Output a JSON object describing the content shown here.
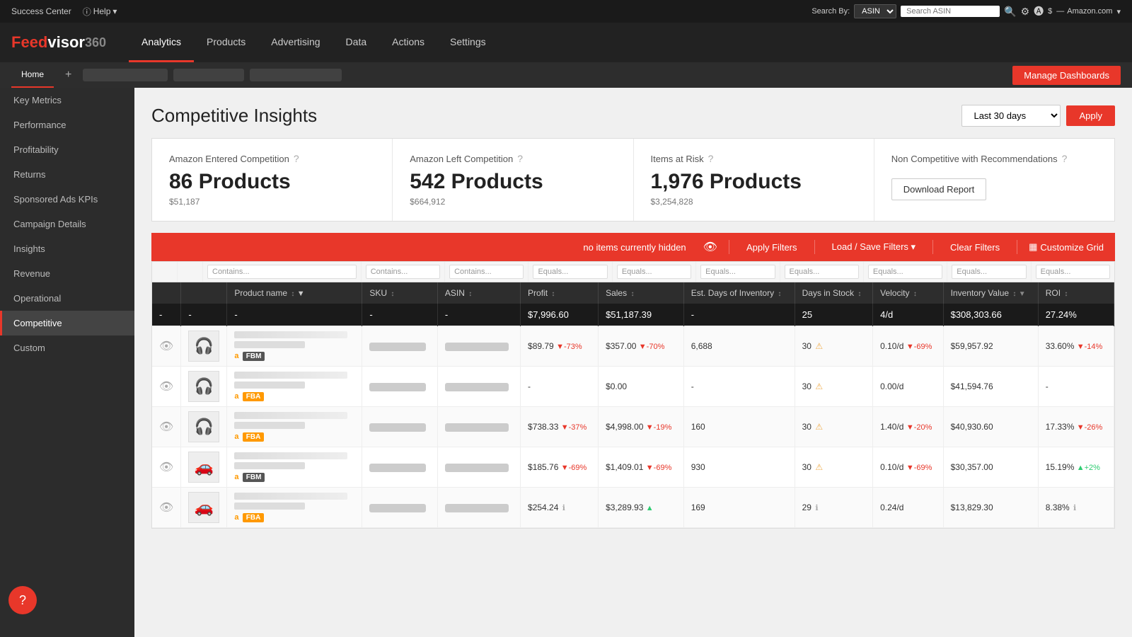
{
  "topbar": {
    "success_center": "Success Center",
    "help": "Help",
    "search_by": "Search By:",
    "search_type": "ASIN",
    "search_placeholder": "Search ASIN",
    "account_label": "Amazon.com"
  },
  "logo": {
    "feed": "Feed",
    "visor": "visor",
    "num": "360"
  },
  "nav": {
    "items": [
      {
        "label": "Analytics",
        "active": true
      },
      {
        "label": "Products",
        "active": false
      },
      {
        "label": "Advertising",
        "active": false
      },
      {
        "label": "Data",
        "active": false
      },
      {
        "label": "Actions",
        "active": false
      },
      {
        "label": "Settings",
        "active": false
      }
    ]
  },
  "tabs": {
    "home": "Home",
    "add": "+",
    "manage_dashboards": "Manage Dashboards"
  },
  "sidebar": {
    "items": [
      {
        "label": "Key Metrics",
        "active": false
      },
      {
        "label": "Performance",
        "active": false
      },
      {
        "label": "Profitability",
        "active": false
      },
      {
        "label": "Returns",
        "active": false
      },
      {
        "label": "Sponsored Ads KPIs",
        "active": false
      },
      {
        "label": "Campaign Details",
        "active": false
      },
      {
        "label": "Insights",
        "active": false
      },
      {
        "label": "Revenue",
        "active": false
      },
      {
        "label": "Operational",
        "active": false
      },
      {
        "label": "Competitive",
        "active": true
      },
      {
        "label": "Custom",
        "active": false
      }
    ]
  },
  "page": {
    "title": "Competitive Insights",
    "date_filter": "Last 30 days",
    "apply_btn": "Apply"
  },
  "cards": [
    {
      "title": "Amazon Entered Competition",
      "count": "86 Products",
      "sub": "$51,187"
    },
    {
      "title": "Amazon Left Competition",
      "count": "542 Products",
      "sub": "$664,912"
    },
    {
      "title": "Items at Risk",
      "count": "1,976 Products",
      "sub": "$3,254,828"
    },
    {
      "title": "Non Competitive with Recommendations",
      "count": "",
      "sub": "",
      "has_download": true,
      "download_label": "Download Report"
    }
  ],
  "filter_bar": {
    "hidden_text": "no items currently hidden",
    "apply_filters": "Apply Filters",
    "load_save": "Load / Save Filters",
    "clear_filters": "Clear Filters",
    "customize": "Customize Grid"
  },
  "table": {
    "col_filters": [
      "Contains...",
      "Contains...",
      "Contains...",
      "Equals...",
      "Equals...",
      "Equals...",
      "Equals...",
      "Equals...",
      "Equals...",
      "Equals..."
    ],
    "headers": [
      {
        "label": "Product name",
        "sortable": true
      },
      {
        "label": "SKU",
        "sortable": true
      },
      {
        "label": "ASIN",
        "sortable": true
      },
      {
        "label": "Profit",
        "sortable": true
      },
      {
        "label": "Sales",
        "sortable": true
      },
      {
        "label": "Est. Days of Inventory",
        "sortable": true
      },
      {
        "label": "Days in Stock",
        "sortable": true
      },
      {
        "label": "Velocity",
        "sortable": true
      },
      {
        "label": "Inventory Value",
        "sortable": true
      },
      {
        "label": "ROI",
        "sortable": true
      }
    ],
    "totals": {
      "profit": "$7,996.60",
      "sales": "$51,187.39",
      "est_days": "-",
      "days_stock": "25",
      "velocity": "4/d",
      "inv_value": "$308,303.66",
      "roi": "27.24%"
    },
    "rows": [
      {
        "profit": "$89.79",
        "profit_trend": "▼-73%",
        "sales": "$357.00",
        "sales_trend": "▼-70%",
        "est_days": "6,688",
        "days_stock": "30",
        "velocity": "0.10/d",
        "velocity_trend": "▼-69%",
        "inv_value": "$59,957.92",
        "roi": "33.60%",
        "roi_trend": "▼-14%",
        "badge": "FBM",
        "img": "🎧"
      },
      {
        "profit": "-",
        "profit_trend": "",
        "sales": "$0.00",
        "sales_trend": "",
        "est_days": "-",
        "days_stock": "30",
        "velocity": "0.00/d",
        "velocity_trend": "",
        "inv_value": "$41,594.76",
        "roi": "-",
        "roi_trend": "",
        "badge": "FBA",
        "img": "🎧"
      },
      {
        "profit": "$738.33",
        "profit_trend": "▼-37%",
        "sales": "$4,998.00",
        "sales_trend": "▼-19%",
        "est_days": "160",
        "days_stock": "30",
        "velocity": "1.40/d",
        "velocity_trend": "▼-20%",
        "inv_value": "$40,930.60",
        "roi": "17.33%",
        "roi_trend": "▼-26%",
        "badge": "FBA",
        "img": "🎧"
      },
      {
        "profit": "$185.76",
        "profit_trend": "▼-69%",
        "sales": "$1,409.01",
        "sales_trend": "▼-69%",
        "est_days": "930",
        "days_stock": "30",
        "velocity": "0.10/d",
        "velocity_trend": "▼-69%",
        "inv_value": "$30,357.00",
        "roi": "15.19%",
        "roi_trend": "▲+2%",
        "badge": "FBM",
        "img": "🚗"
      },
      {
        "profit": "$254.24",
        "profit_trend": "",
        "sales": "$3,289.93",
        "sales_trend": "▲",
        "est_days": "169",
        "days_stock": "29",
        "velocity": "0.24/d",
        "velocity_trend": "",
        "inv_value": "$13,829.30",
        "roi": "8.38%",
        "roi_trend": "",
        "badge": "FBA",
        "img": "🚗"
      }
    ]
  }
}
